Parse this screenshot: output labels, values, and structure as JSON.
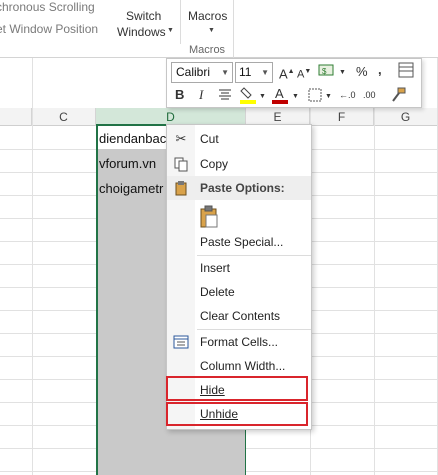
{
  "ribbon": {
    "sync_scrolling": "chronous Scrolling",
    "reset_position": "et Window Position",
    "switch_windows_line1": "Switch",
    "switch_windows_line2": "Windows",
    "macros_button": "Macros",
    "macros_group": "Macros"
  },
  "grid": {
    "columns": [
      "C",
      "D",
      "E",
      "F",
      "G"
    ],
    "cells": [
      "diendanbac",
      "vforum.vn",
      "choigametr"
    ]
  },
  "mini_toolbar": {
    "font_name": "Calibri",
    "font_size": "11",
    "accent_color": "#c00000",
    "highlight_color": "#ffff00"
  },
  "context_menu": {
    "items": [
      {
        "label": "Cut",
        "icon": "scissors-icon"
      },
      {
        "label": "Copy",
        "icon": "copy-icon"
      },
      {
        "label": "Paste Options:",
        "icon": "paste-icon"
      },
      {
        "label": "Paste Special...",
        "icon": ""
      },
      {
        "label": "Insert",
        "icon": ""
      },
      {
        "label": "Delete",
        "icon": ""
      },
      {
        "label": "Clear Contents",
        "icon": ""
      },
      {
        "label": "Format Cells...",
        "icon": "format-cells-icon"
      },
      {
        "label": "Column Width...",
        "icon": ""
      },
      {
        "label": "Hide",
        "icon": ""
      },
      {
        "label": "Unhide",
        "icon": ""
      }
    ],
    "highlight_color": "#d9252c"
  }
}
